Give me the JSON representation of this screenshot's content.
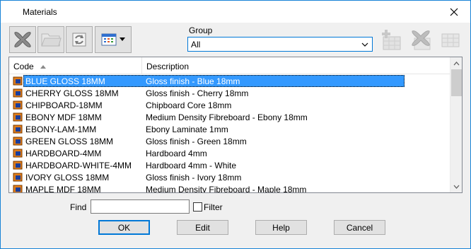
{
  "window": {
    "title": "Materials",
    "close_icon": "close-icon"
  },
  "toolbar": {
    "left_buttons": [
      {
        "name": "delete-button",
        "icon": "delete-x-icon",
        "enabled": true
      },
      {
        "name": "open-folder-button",
        "icon": "folder-icon",
        "enabled": false
      },
      {
        "name": "refresh-button",
        "icon": "refresh-icon",
        "enabled": true
      },
      {
        "name": "view-menu-button",
        "icon": "list-view-icon",
        "enabled": true
      }
    ],
    "group_label": "Group",
    "group_value": "All",
    "right_buttons": [
      {
        "name": "add-group-button",
        "icon": "add-grid-icon",
        "enabled": false
      },
      {
        "name": "delete-group-button",
        "icon": "delete-x-icon",
        "enabled": false
      },
      {
        "name": "edit-group-button",
        "icon": "grid-edit-icon",
        "enabled": false
      }
    ]
  },
  "list": {
    "columns": {
      "code": "Code",
      "description": "Description"
    },
    "rows": [
      {
        "code": "BLUE GLOSS 18MM",
        "description": "Gloss finish - Blue 18mm",
        "selected": true
      },
      {
        "code": "CHERRY GLOSS 18MM",
        "description": "Gloss finish - Cherry 18mm"
      },
      {
        "code": "CHIPBOARD-18MM",
        "description": "Chipboard Core 18mm"
      },
      {
        "code": "EBONY MDF 18MM",
        "description": "Medium Density Fibreboard - Ebony 18mm"
      },
      {
        "code": "EBONY-LAM-1MM",
        "description": "Ebony Laminate 1mm"
      },
      {
        "code": "GREEN GLOSS 18MM",
        "description": "Gloss finish - Green 18mm"
      },
      {
        "code": "HARDBOARD-4MM",
        "description": "Hardboard 4mm"
      },
      {
        "code": "HARDBOARD-WHITE-4MM",
        "description": "Hardboard 4mm - White"
      },
      {
        "code": "IVORY GLOSS 18MM",
        "description": "Gloss finish - Ivory 18mm"
      },
      {
        "code": "MAPLE MDF 18MM",
        "description": "Medium Density Fibreboard - Maple 18mm"
      }
    ]
  },
  "find": {
    "label": "Find",
    "value": "",
    "filter_label": "Filter",
    "filter_checked": false
  },
  "buttons": {
    "ok": "OK",
    "edit": "Edit",
    "help": "Help",
    "cancel": "Cancel"
  },
  "colors": {
    "selection": "#3399ff",
    "accent": "#0078d7",
    "material_icon": "#e07d1a"
  }
}
